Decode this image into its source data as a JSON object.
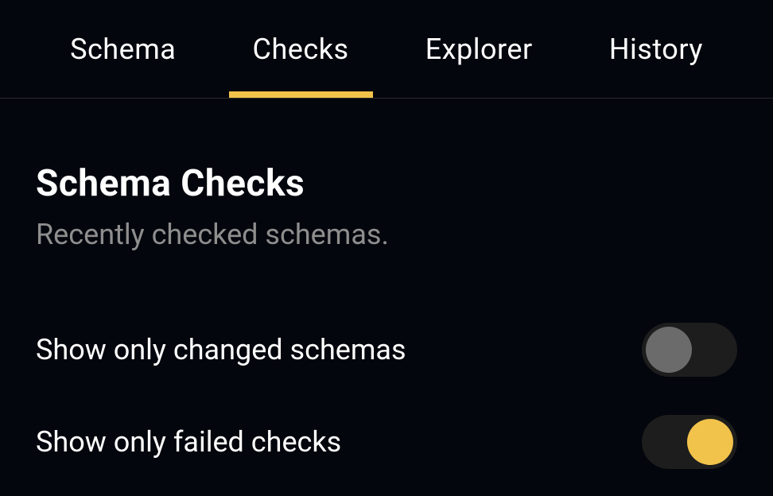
{
  "tabs": [
    {
      "label": "Schema",
      "active": false
    },
    {
      "label": "Checks",
      "active": true
    },
    {
      "label": "Explorer",
      "active": false
    },
    {
      "label": "History",
      "active": false
    }
  ],
  "page": {
    "title": "Schema Checks",
    "subtitle": "Recently checked schemas."
  },
  "toggles": {
    "changed_schemas": {
      "label": "Show only changed schemas",
      "value": false
    },
    "failed_checks": {
      "label": "Show only failed checks",
      "value": true
    }
  },
  "colors": {
    "background": "#04060d",
    "accent": "#f2c34b",
    "text_primary": "#ffffff",
    "text_secondary": "#8e8e8e",
    "toggle_track": "#1d1d1d",
    "toggle_knob_off": "#6b6b6b"
  }
}
